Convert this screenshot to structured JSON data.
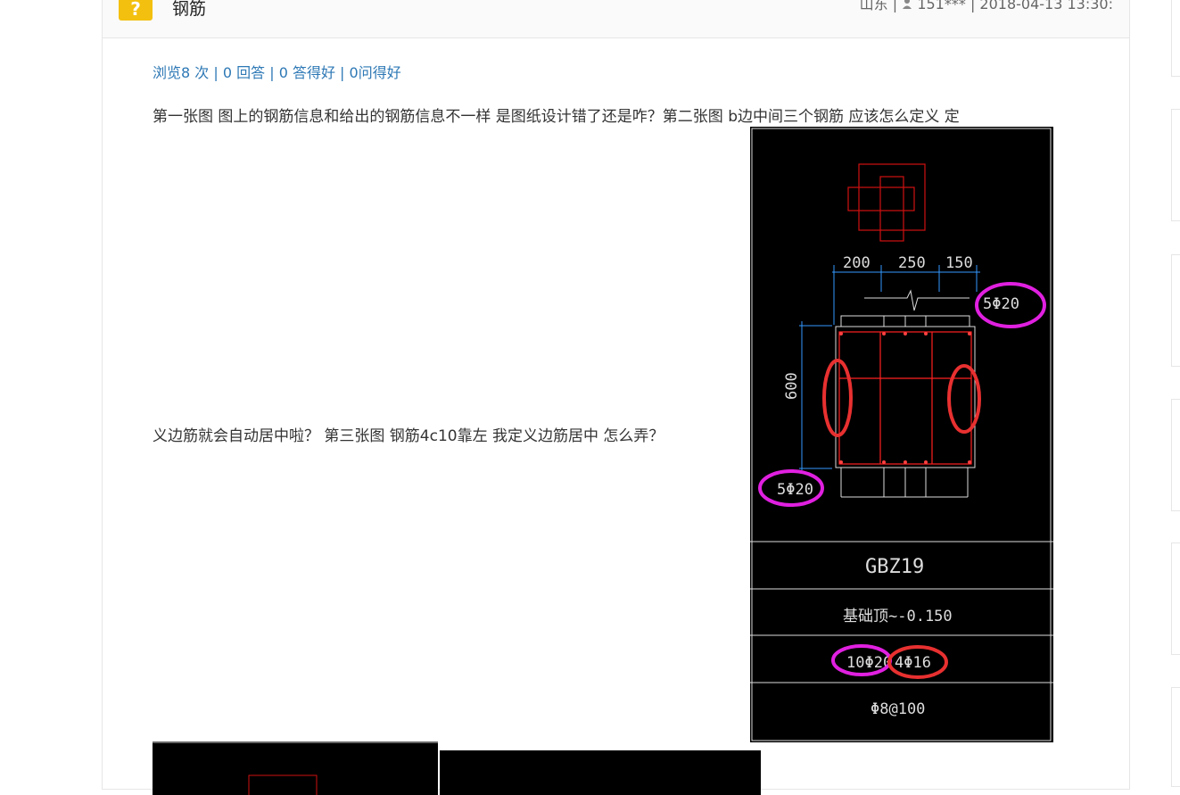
{
  "question": {
    "icon": "?",
    "title": "钢筋",
    "meta": "山东 | ",
    "user": "151***",
    "time": " | 2018-04-13 13:30:",
    "stats": {
      "views": "浏览8 次",
      "answers": "0 回答",
      "good_answers": "0 答得好",
      "good_questions": "0问得好",
      "sep": " | "
    },
    "body_line1": "第一张图 图上的钢筋信息和给出的钢筋信息不一样 是图纸设计错了还是咋？第二张图 b边中间三个钢筋 应该怎么定义 定",
    "body_line2": "义边筋就会自动居中啦？ 第三张图 钢筋4c10靠左 我定义边筋居中 怎么弄？"
  },
  "drawing": {
    "dims": [
      "200",
      "250",
      "150"
    ],
    "height_dim": "600",
    "top_bar": "5Φ20",
    "bottom_bar": "5Φ20",
    "table": {
      "name": "GBZ19",
      "elevation": "基础顶~-0.150",
      "rebar_a": "10Φ20",
      "rebar_b": "4Φ16",
      "stirrup": "Φ8@100"
    },
    "colors": {
      "bg": "#000000",
      "rebar": "#ff2020",
      "dim": "#3399ff",
      "mark_magenta": "#e020e0",
      "mark_red": "#e83030"
    }
  },
  "icons": {
    "user": "user-icon",
    "question": "question-icon"
  }
}
